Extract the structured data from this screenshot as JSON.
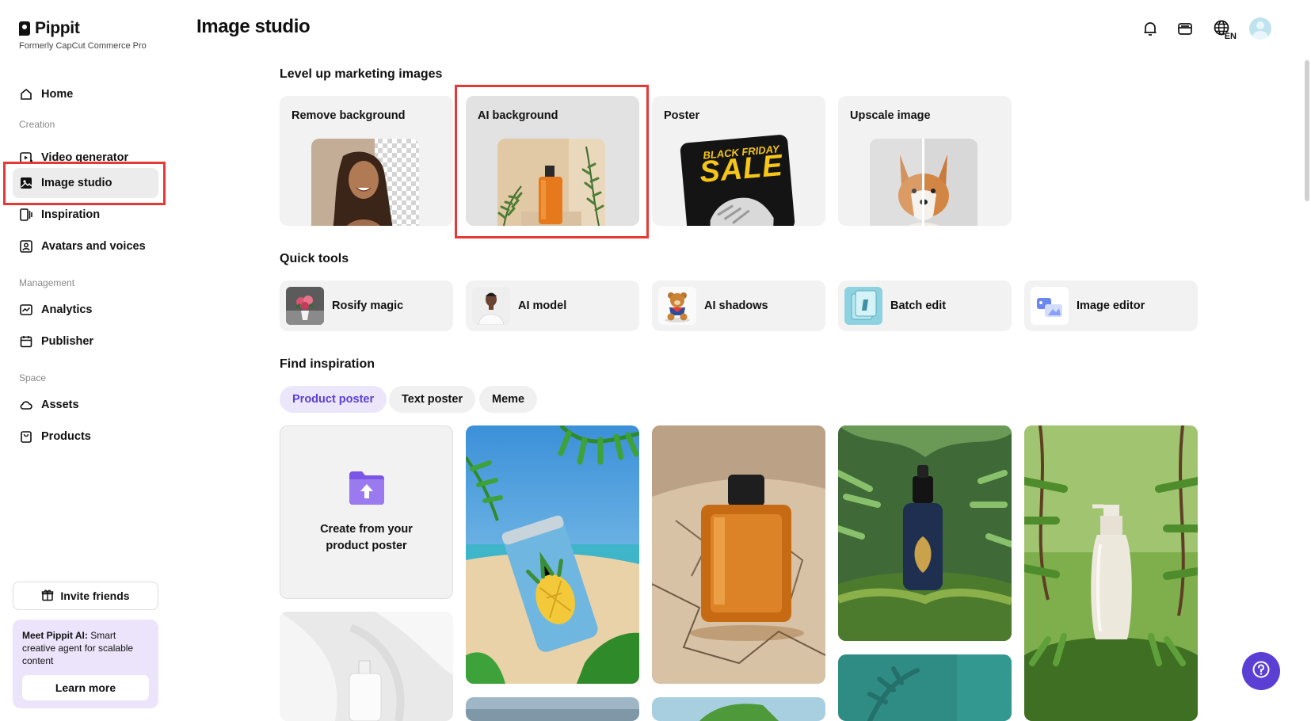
{
  "app": {
    "logo": "Pippit",
    "subtitle": "Formerly CapCut Commerce Pro"
  },
  "sidebar": {
    "items": [
      {
        "label": "Home",
        "icon": "home-icon"
      },
      {
        "label": "Video generator",
        "icon": "video-generator-icon"
      },
      {
        "label": "Image studio",
        "icon": "image-studio-icon",
        "active": true
      },
      {
        "label": "Inspiration",
        "icon": "inspiration-icon"
      },
      {
        "label": "Avatars and voices",
        "icon": "avatar-voice-icon"
      },
      {
        "label": "Analytics",
        "icon": "analytics-icon"
      },
      {
        "label": "Publisher",
        "icon": "calendar-icon"
      },
      {
        "label": "Assets",
        "icon": "cloud-icon"
      },
      {
        "label": "Products",
        "icon": "bag-icon"
      }
    ],
    "sections": [
      "Creation",
      "Management",
      "Space"
    ],
    "invite_label": "Invite friends",
    "promo": {
      "bold": "Meet Pippit AI:",
      "text": " Smart creative agent for scalable content",
      "button": "Learn more"
    }
  },
  "header": {
    "title": "Image studio",
    "lang": "EN"
  },
  "marketing": {
    "title": "Level up marketing images",
    "cards": [
      {
        "label": "Remove background"
      },
      {
        "label": "AI background"
      },
      {
        "label": "Poster",
        "poster_small": "BLACK FRIDAY",
        "poster_big": "SALE"
      },
      {
        "label": "Upscale image"
      }
    ]
  },
  "quick_tools": {
    "title": "Quick tools",
    "items": [
      {
        "label": "Rosify magic"
      },
      {
        "label": "AI model"
      },
      {
        "label": "AI shadows"
      },
      {
        "label": "Batch edit"
      },
      {
        "label": "Image editor"
      }
    ]
  },
  "inspiration": {
    "title": "Find inspiration",
    "chips": [
      {
        "label": "Product poster",
        "active": true
      },
      {
        "label": "Text poster"
      },
      {
        "label": "Meme"
      }
    ],
    "create_label": "Create from your product poster"
  },
  "colors": {
    "accent": "#5b3fd4",
    "highlight": "#e53935",
    "card_bg": "#f2f2f2"
  }
}
